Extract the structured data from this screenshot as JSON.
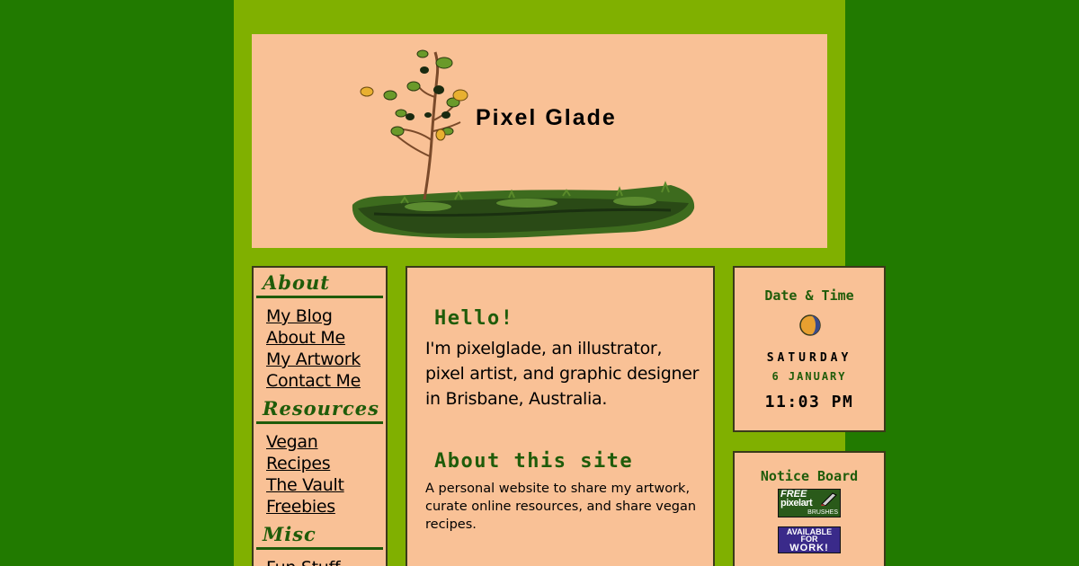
{
  "site": {
    "title": "Pixel Glade"
  },
  "sidebar": {
    "sections": [
      {
        "heading": "About",
        "links": [
          "My Blog",
          "About Me",
          "My Artwork",
          "Contact Me"
        ]
      },
      {
        "heading": "Resources",
        "links": [
          "Vegan Recipes",
          "The Vault",
          "Freebies"
        ]
      },
      {
        "heading": "Misc",
        "links": [
          "Fun Stuff"
        ]
      }
    ]
  },
  "main": {
    "hello_heading": "Hello!",
    "hello_text": "I'm pixelglade, an illustrator, pixel artist, and graphic designer in Brisbane, Australia.",
    "about_heading": "About this site",
    "about_text": "A personal website to share my artwork, curate online resources, and share vegan recipes."
  },
  "datetime": {
    "heading": "Date & Time",
    "icon": "moon-phase-icon",
    "weekday": "SATURDAY",
    "date": "6 JANUARY",
    "time": "11:03 PM"
  },
  "notice": {
    "heading": "Notice Board",
    "badge1": {
      "line1": "FREE",
      "line2": "pixelart",
      "line3": "BRUSHES"
    },
    "badge2": {
      "line1": "AVAILABLE",
      "line2": "FOR",
      "line3": "WORK!"
    }
  },
  "colors": {
    "background": "#217a00",
    "column": "#80b000",
    "panel": "#f9c196",
    "heading": "#1f5c0a"
  }
}
